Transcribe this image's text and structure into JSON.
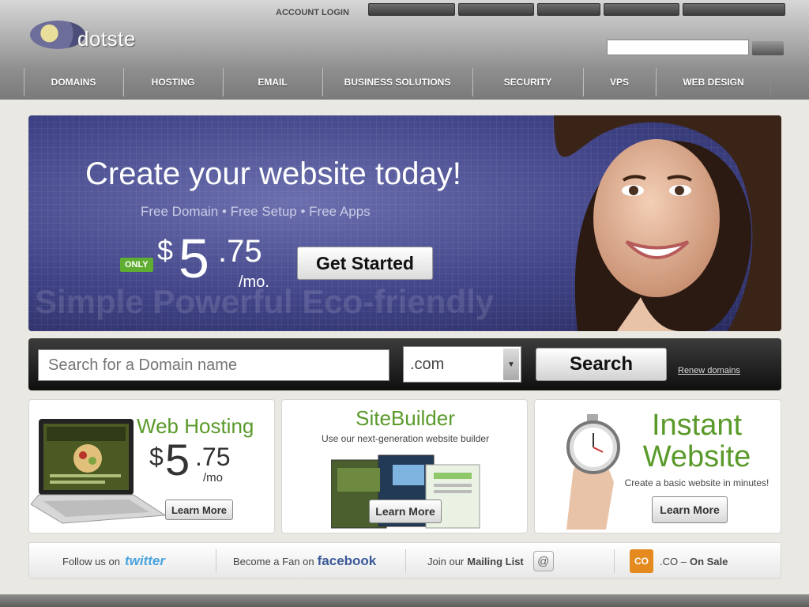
{
  "header": {
    "logo_text": "dotste",
    "account_login": "ACCOUNT LOGIN",
    "login_field_placeholder": "",
    "nav": [
      {
        "label": "DOMAINS"
      },
      {
        "label": "HOSTING"
      },
      {
        "label": "EMAIL"
      },
      {
        "label": "BUSINESS SOLUTIONS"
      },
      {
        "label": "SECURITY"
      },
      {
        "label": "VPS"
      },
      {
        "label": "WEB DESIGN"
      }
    ]
  },
  "hero": {
    "title": "Create your website today!",
    "subtitle": "Free Domain • Free Setup • Free Apps",
    "only_badge": "ONLY",
    "price_dollar": "$",
    "price_whole": "5",
    "price_cents": ".75",
    "price_period": "/mo.",
    "cta_label": "Get Started",
    "watermark": "Simple  Powerful  Eco-friendly"
  },
  "domain_search": {
    "placeholder": "Search for a Domain name",
    "tld_selected": ".com",
    "search_label": "Search",
    "links": [
      "Renew domains"
    ]
  },
  "cards": {
    "web_hosting": {
      "title": "Web Hosting",
      "price_dollar": "$",
      "price_whole": "5",
      "price_cents": ".75",
      "price_period": "/mo",
      "learn_more": "Learn More"
    },
    "sitebuilder": {
      "title": "SiteBuilder",
      "tagline": "Use our next-generation website builder",
      "learn_more": "Learn More"
    },
    "instant_website": {
      "title_line1": "Instant",
      "title_line2": "Website",
      "tagline": "Create a basic website in minutes!",
      "learn_more": "Learn More"
    }
  },
  "social": {
    "twitter_prefix": "Follow us on",
    "twitter_brand": "twitter",
    "facebook_prefix": "Become a Fan on",
    "facebook_brand": "facebook",
    "mailing_prefix": "Join our",
    "mailing_label": "Mailing List",
    "co_prefix": ".CO –",
    "co_label": "On Sale",
    "co_badge": "CO"
  },
  "colors": {
    "accent_green": "#5a9a2a",
    "hero_blue": "#3f4386",
    "twitter_blue": "#4aa3df",
    "facebook_blue": "#3b5998",
    "co_orange": "#e58a1f"
  }
}
